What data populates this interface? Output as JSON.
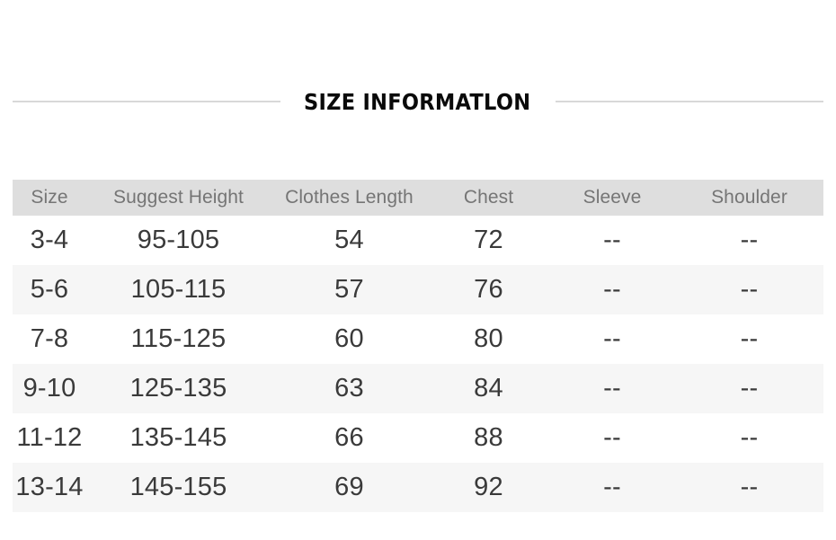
{
  "title": {
    "text": "SIZE INFORMATLON"
  },
  "table": {
    "headers": [
      "Size",
      "Suggest Height",
      "Clothes Length",
      "Chest",
      "Sleeve",
      "Shoulder"
    ],
    "rows": [
      {
        "size": "3-4",
        "suggest_height": "95-105",
        "clothes_length": "54",
        "chest": "72",
        "sleeve": "--",
        "shoulder": "--"
      },
      {
        "size": "5-6",
        "suggest_height": "105-115",
        "clothes_length": "57",
        "chest": "76",
        "sleeve": "--",
        "shoulder": "--"
      },
      {
        "size": "7-8",
        "suggest_height": "115-125",
        "clothes_length": "60",
        "chest": "80",
        "sleeve": "--",
        "shoulder": "--"
      },
      {
        "size": "9-10",
        "suggest_height": "125-135",
        "clothes_length": "63",
        "chest": "84",
        "sleeve": "--",
        "shoulder": "--"
      },
      {
        "size": "11-12",
        "suggest_height": "135-145",
        "clothes_length": "66",
        "chest": "88",
        "sleeve": "--",
        "shoulder": "--"
      },
      {
        "size": "13-14",
        "suggest_height": "145-155",
        "clothes_length": "69",
        "chest": "92",
        "sleeve": "--",
        "shoulder": "--"
      }
    ]
  },
  "colors": {
    "header_background": "#dedede",
    "header_text": "#757575",
    "body_text": "#3a3a3a",
    "stripe_background": "#f6f6f6",
    "rule": "#d8d8d8",
    "title_text": "#0a0a0a",
    "page_background": "#ffffff"
  }
}
